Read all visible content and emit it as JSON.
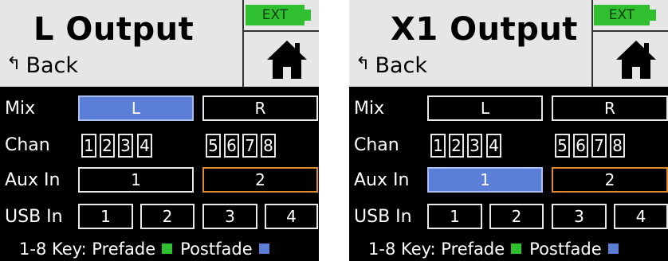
{
  "colors": {
    "prefade": "#2fbf2f",
    "postfade": "#5b7fd6",
    "selected": "#5b7fd6",
    "highlight_border": "#e08a2a"
  },
  "screens": [
    {
      "title": "L Output",
      "back_label": "Back",
      "ext_label": "EXT",
      "rows": {
        "mix": {
          "label": "Mix",
          "cells": [
            "L",
            "R"
          ]
        },
        "chan": {
          "label": "Chan",
          "cells": [
            "1",
            "2",
            "3",
            "4",
            "5",
            "6",
            "7",
            "8"
          ]
        },
        "aux": {
          "label": "Aux In",
          "cells": [
            "1",
            "2"
          ]
        },
        "usb": {
          "label": "USB In",
          "cells": [
            "1",
            "2",
            "3",
            "4"
          ]
        }
      },
      "key": {
        "prefix": "1-8 Key: Prefade",
        "postfade": "Postfade"
      }
    },
    {
      "title": "X1 Output",
      "back_label": "Back",
      "ext_label": "EXT",
      "rows": {
        "mix": {
          "label": "Mix",
          "cells": [
            "L",
            "R"
          ]
        },
        "chan": {
          "label": "Chan",
          "cells": [
            "1",
            "2",
            "3",
            "4",
            "5",
            "6",
            "7",
            "8"
          ]
        },
        "aux": {
          "label": "Aux In",
          "cells": [
            "1",
            "2"
          ]
        },
        "usb": {
          "label": "USB In",
          "cells": [
            "1",
            "2",
            "3",
            "4"
          ]
        }
      },
      "key": {
        "prefix": "1-8 Key: Prefade",
        "postfade": "Postfade"
      }
    }
  ]
}
